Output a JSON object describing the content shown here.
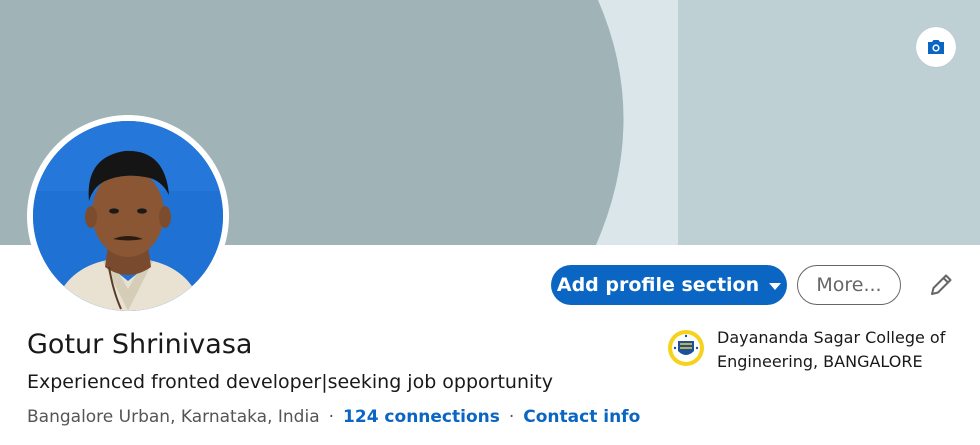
{
  "banner": {
    "background_colors": [
      "#bfd0d4",
      "#a0b3b7",
      "#dae6ea"
    ],
    "camera_icon": "camera-icon"
  },
  "profile": {
    "photo_label": "profile photo",
    "name": "Gotur Shrinivasa",
    "headline": "Experienced fronted developer|seeking job opportunity",
    "location": "Bangalore Urban, Karnataka, India",
    "separator": "·",
    "connections": "124 connections",
    "contact_info": "Contact info"
  },
  "actions": {
    "add_section_label": "Add profile section",
    "more_label": "More...",
    "edit_icon": "pencil-icon"
  },
  "education": {
    "school": "Dayananda Sagar College of Engineering, BANGALORE",
    "logo_icon": "college-crest-icon"
  },
  "colors": {
    "primary": "#0a66c2",
    "text": "#191919",
    "muted": "#555555"
  }
}
